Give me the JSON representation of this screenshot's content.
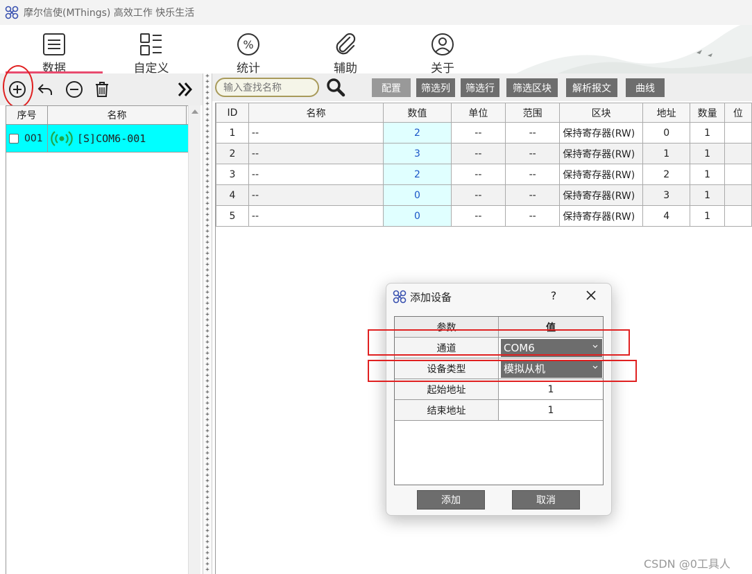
{
  "window": {
    "title": "摩尔信使(MThings) 高效工作 快乐生活",
    "icon": "app-logo-icon"
  },
  "nav": {
    "items": [
      {
        "label": "数据",
        "icon": "list-doc-icon"
      },
      {
        "label": "自定义",
        "icon": "layout-grid-icon"
      },
      {
        "label": "统计",
        "icon": "percent-icon"
      },
      {
        "label": "辅助",
        "icon": "paperclip-icon"
      },
      {
        "label": "关于",
        "icon": "user-icon"
      }
    ],
    "active_index": 0,
    "accent_color": "#e84a6e"
  },
  "left_toolbar": {
    "icons": [
      "add-circle-icon",
      "undo-icon",
      "remove-circle-icon",
      "trash-icon",
      "double-chevron-right-icon"
    ]
  },
  "device_list": {
    "headers": [
      "序号",
      "名称"
    ],
    "rows": [
      {
        "index": "001",
        "name": "[S]COM6-001",
        "icon": "signal-icon",
        "checked": false
      }
    ],
    "highlight_color": "#00ffff"
  },
  "right_toolbar": {
    "search_placeholder": "输入查找名称",
    "buttons": [
      "配置",
      "筛选列",
      "筛选行",
      "筛选区块",
      "解析报文",
      "曲线"
    ]
  },
  "table": {
    "headers": [
      "ID",
      "名称",
      "数值",
      "单位",
      "范围",
      "区块",
      "地址",
      "数量",
      "位"
    ],
    "rows": [
      [
        "1",
        "--",
        "2",
        "--",
        "--",
        "保持寄存器(RW)",
        "0",
        "1"
      ],
      [
        "2",
        "--",
        "3",
        "--",
        "--",
        "保持寄存器(RW)",
        "1",
        "1"
      ],
      [
        "3",
        "--",
        "2",
        "--",
        "--",
        "保持寄存器(RW)",
        "2",
        "1"
      ],
      [
        "4",
        "--",
        "0",
        "--",
        "--",
        "保持寄存器(RW)",
        "3",
        "1"
      ],
      [
        "5",
        "--",
        "0",
        "--",
        "--",
        "保持寄存器(RW)",
        "4",
        "1"
      ]
    ]
  },
  "dialog": {
    "title": "添加设备",
    "help": "?",
    "header": {
      "param": "参数",
      "value": "值"
    },
    "params": [
      {
        "label": "通道",
        "value": "COM6",
        "type": "select"
      },
      {
        "label": "设备类型",
        "value": "模拟从机",
        "type": "select"
      },
      {
        "label": "起始地址",
        "value": "1",
        "type": "text"
      },
      {
        "label": "结束地址",
        "value": "1",
        "type": "text"
      }
    ],
    "ok_label": "添加",
    "cancel_label": "取消"
  },
  "watermark": "CSDN @0工具人"
}
